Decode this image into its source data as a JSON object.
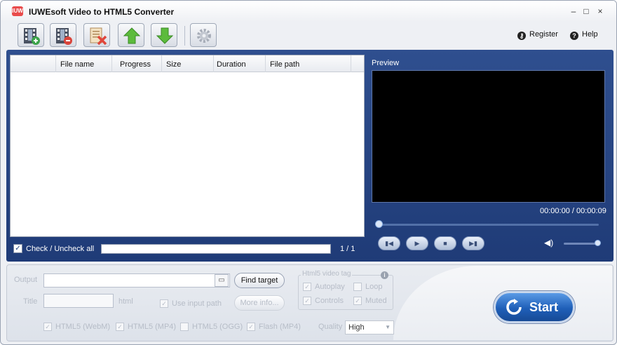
{
  "app": {
    "title": "IUWEsoft Video to HTML5 Converter",
    "icon_text": "IUW"
  },
  "window_controls": {
    "minimize": "–",
    "maximize": "□",
    "close": "×"
  },
  "toolbar": {
    "buttons": [
      {
        "name": "add-video",
        "icon": "film-add-icon"
      },
      {
        "name": "remove-video",
        "icon": "film-remove-icon"
      },
      {
        "name": "clear-list",
        "icon": "clear-list-icon"
      },
      {
        "name": "move-up",
        "icon": "arrow-up-icon"
      },
      {
        "name": "move-down",
        "icon": "arrow-down-icon"
      },
      {
        "name": "settings",
        "icon": "gear-icon"
      }
    ],
    "register_label": "Register",
    "help_label": "Help"
  },
  "file_list": {
    "columns": [
      "File name",
      "Progress",
      "Size",
      "Duration",
      "File path"
    ],
    "rows": [],
    "check_all_label": "Check / Uncheck all",
    "page": "1 / 1"
  },
  "preview": {
    "label": "Preview",
    "timecode": "00:00:00 / 00:00:09",
    "seek_fraction": 0.0,
    "volume_fraction": 1.0
  },
  "output": {
    "output_label": "Output",
    "output_value": "",
    "find_target_label": "Find target",
    "title_label": "Title",
    "title_value": "",
    "title_suffix": "html",
    "use_input_path_label": "Use input path",
    "more_info_label": "More info...",
    "html5_tag": {
      "title": "Html5 video tag",
      "autoplay_label": "Autoplay",
      "loop_label": "Loop",
      "controls_label": "Controls",
      "muted_label": "Muted"
    },
    "formats": {
      "webm_label": "HTML5 (WebM)",
      "mp4_label": "HTML5 (MP4)",
      "ogg_label": "HTML5 (OGG)",
      "flash_label": "Flash (MP4)"
    },
    "quality_label": "Quality",
    "quality_value": "High"
  },
  "start": {
    "label": "Start"
  }
}
